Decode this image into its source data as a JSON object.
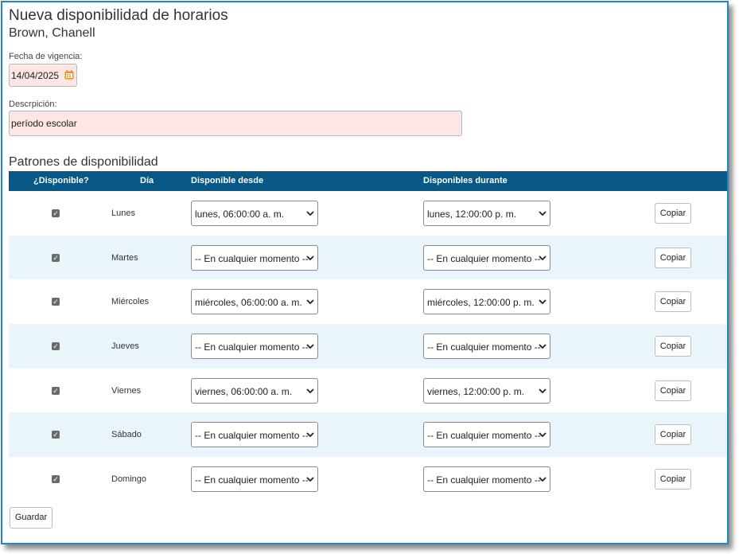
{
  "header": {
    "title": "Nueva disponibilidad de horarios",
    "employee": "Brown, Chanell"
  },
  "form": {
    "date_label": "Fecha de vigencia:",
    "date_value": "14/04/2025",
    "date_icon": "calendar-icon",
    "description_label": "Descrpición:",
    "description_value": "período escolar"
  },
  "patterns": {
    "section_title": "Patrones de disponibilidad",
    "columns": {
      "available": "¿Disponible?",
      "day": "Día",
      "from": "Disponible desde",
      "during": "Disponibles durante"
    },
    "copy_label": "Copiar",
    "rows": [
      {
        "day": "Lunes",
        "available": true,
        "from": "lunes, 06:00:00 a. m.",
        "during": "lunes, 12:00:00 p. m."
      },
      {
        "day": "Martes",
        "available": true,
        "from": "-- En cualquier momento --",
        "during": "-- En cualquier momento --"
      },
      {
        "day": "Miércoles",
        "available": true,
        "from": "miércoles, 06:00:00 a. m.",
        "during": "miércoles, 12:00:00 p. m."
      },
      {
        "day": "Jueves",
        "available": true,
        "from": "-- En cualquier momento --",
        "during": "-- En cualquier momento --"
      },
      {
        "day": "Viernes",
        "available": true,
        "from": "viernes, 06:00:00 a. m.",
        "during": "viernes, 12:00:00 p. m."
      },
      {
        "day": "Sábado",
        "available": true,
        "from": "-- En cualquier momento --",
        "during": "-- En cualquier momento --"
      },
      {
        "day": "Domingo",
        "available": true,
        "from": "-- En cualquier momento --",
        "during": "-- En cualquier momento --"
      }
    ]
  },
  "footer": {
    "save_label": "Guardar"
  },
  "colors": {
    "header_bar": "#085887",
    "frame_border": "#1b88c8",
    "required_field_bg": "#fde6e4",
    "alt_row_bg": "#eaf4fb",
    "calendar_icon": "#f0902a"
  }
}
